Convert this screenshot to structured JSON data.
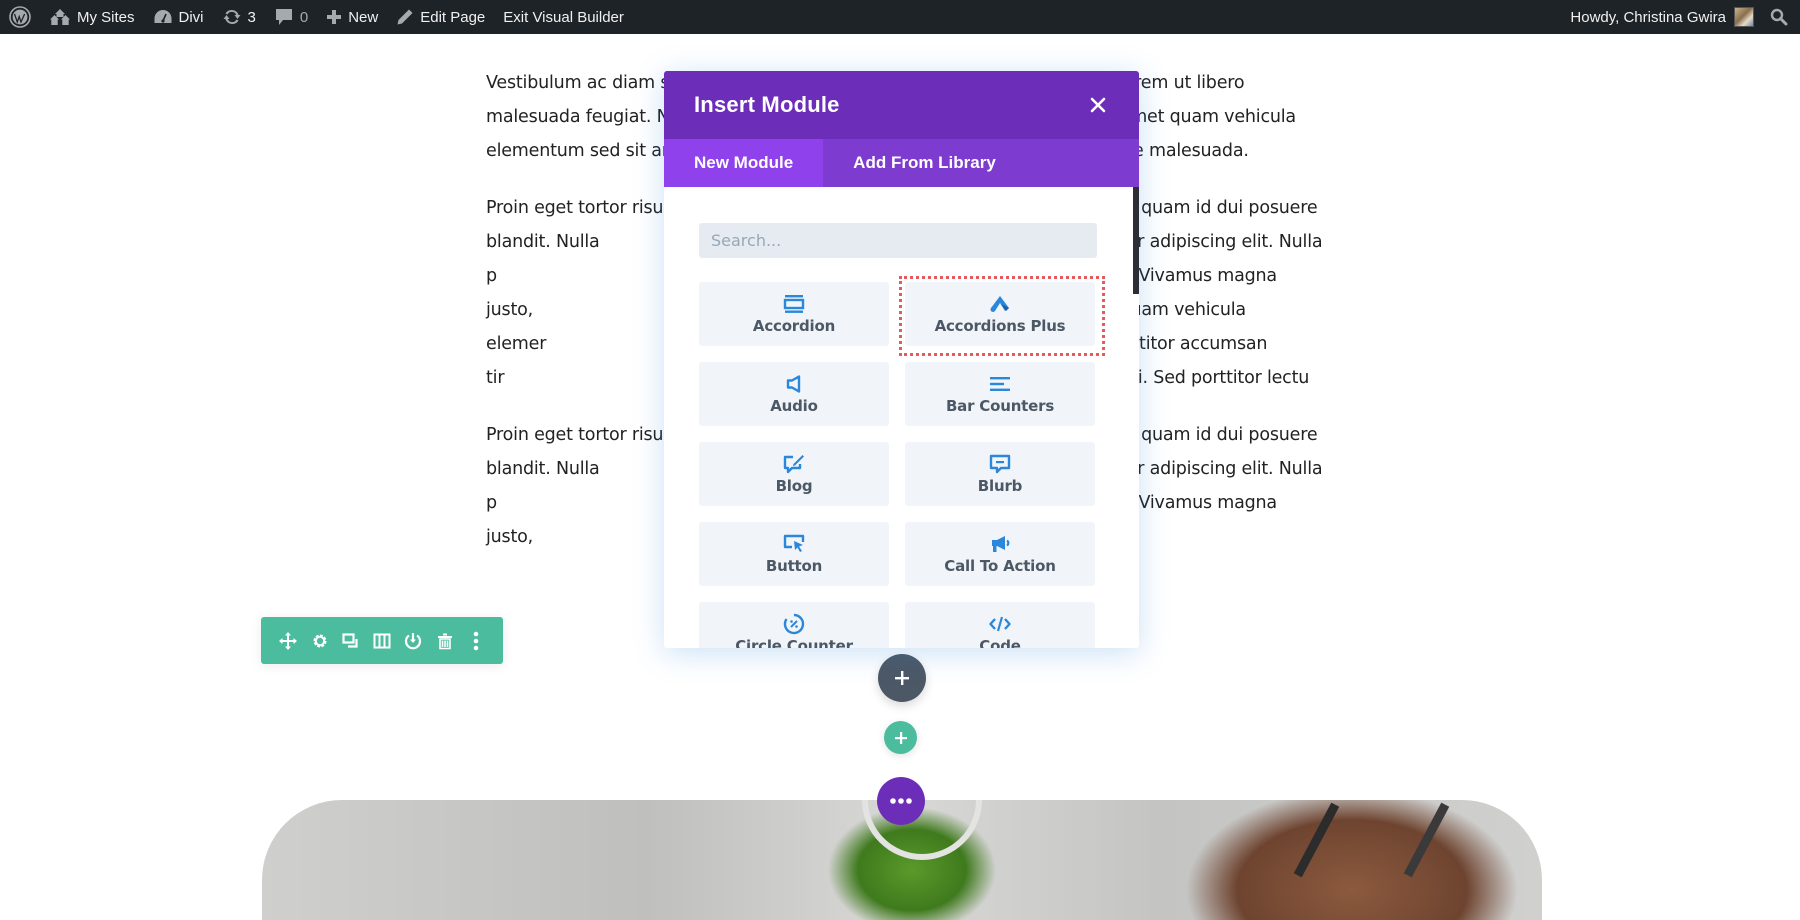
{
  "adminbar": {
    "items": [
      {
        "icon": "wordpress-logo-icon",
        "label": ""
      },
      {
        "icon": "my-sites-icon",
        "label": "My Sites"
      },
      {
        "icon": "divi-dashboard-icon",
        "label": "Divi"
      },
      {
        "icon": "updates-icon",
        "label": "3"
      },
      {
        "icon": "comments-icon",
        "label": "0"
      },
      {
        "icon": "plus-icon",
        "label": "New"
      },
      {
        "icon": "pencil-icon",
        "label": "Edit Page"
      },
      {
        "icon": "",
        "label": "Exit Visual Builder"
      }
    ],
    "greeting": "Howdy, Christina Gwira",
    "search_icon": "search-icon"
  },
  "content": {
    "paragraphs": [
      "Vestibulum ac diam si                        uis lorem ut libero malesuada feugiat. Nu                          met quam vehicula elementum sed sit am                          ie malesuada.",
      "Proin eget tortor risus                        liquet quam id dui posuere blandit. Nulla                         , consectetur adipiscing elit. Nulla p                          elis porttitor volutpat. Vivamus magna justo,                        m ac diam sit amet quam vehicula elemer                          feugiat. Nulla porttitor accumsan tir                          ntum sed sit amet dui. Sed porttitor lectu",
      "Proin eget tortor risus                        liquet quam id dui posuere blandit. Nulla                         , consectetur adipiscing elit. Nulla p                          elis porttitor volutpat. Vivamus magna justo,"
    ]
  },
  "row_toolbar": {
    "actions": [
      "move",
      "settings",
      "duplicate",
      "columns",
      "save-to-library",
      "delete",
      "more"
    ]
  },
  "modal": {
    "title": "Insert Module",
    "tabs": [
      {
        "label": "New Module",
        "active": true
      },
      {
        "label": "Add From Library",
        "active": false
      }
    ],
    "search_placeholder": "Search...",
    "search_value": "",
    "modules": [
      {
        "label": "Accordion",
        "icon": "accordion-icon",
        "highlighted": false
      },
      {
        "label": "Accordions Plus",
        "icon": "accordions-plus-icon",
        "highlighted": true
      },
      {
        "label": "Audio",
        "icon": "audio-icon",
        "highlighted": false
      },
      {
        "label": "Bar Counters",
        "icon": "bar-counters-icon",
        "highlighted": false
      },
      {
        "label": "Blog",
        "icon": "blog-icon",
        "highlighted": false
      },
      {
        "label": "Blurb",
        "icon": "blurb-icon",
        "highlighted": false
      },
      {
        "label": "Button",
        "icon": "button-icon",
        "highlighted": false
      },
      {
        "label": "Call To Action",
        "icon": "call-to-action-icon",
        "highlighted": false
      },
      {
        "label": "Circle Counter",
        "icon": "circle-counter-icon",
        "highlighted": false
      },
      {
        "label": "Code",
        "icon": "code-icon",
        "highlighted": false
      }
    ]
  },
  "colors": {
    "modal_header": "#6c2eb9",
    "modal_tabs": "#7d3bcf",
    "active_tab": "#8f42ec",
    "module_icon": "#2b87da",
    "row_toolbar": "#4bbd9e",
    "add_module_button": "#4c5866",
    "add_row_button": "#4bbd9e",
    "section_button": "#6c2eb9",
    "highlight_border": "#e55a5a"
  }
}
